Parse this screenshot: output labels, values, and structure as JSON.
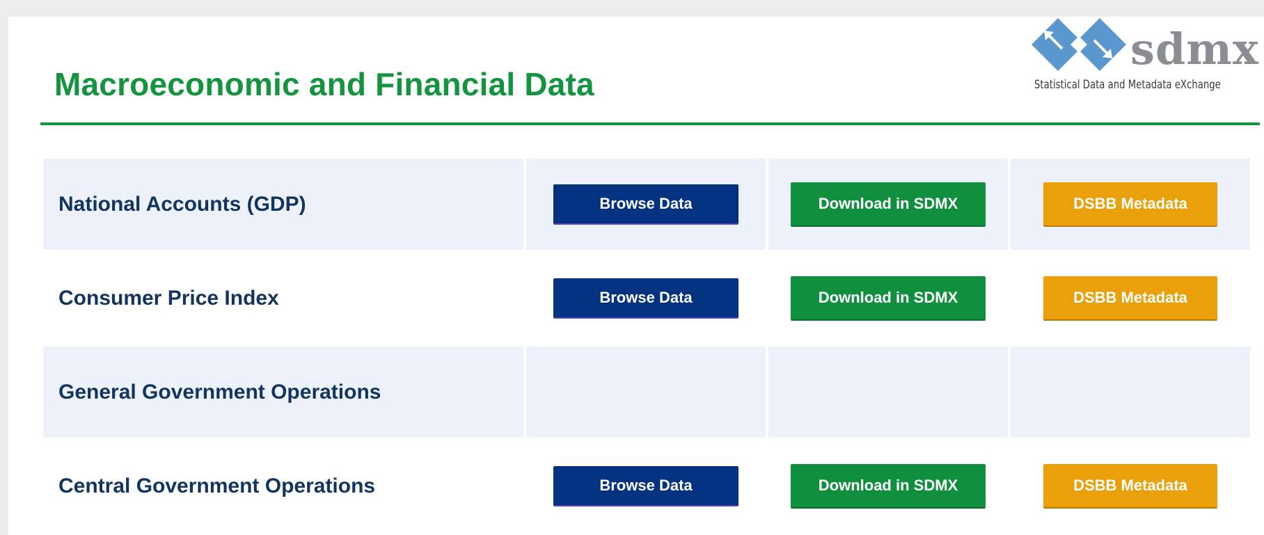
{
  "header": {
    "title": "Macroeconomic and Financial Data"
  },
  "logo": {
    "word": "sdmx",
    "tagline": "Statistical Data and Metadata eXchange",
    "colors": {
      "diamond": "#5b97cf",
      "word": "#8a8e92"
    }
  },
  "colors": {
    "title_green": "#14943f",
    "browse_blue": "#033280",
    "download_green": "#10903f",
    "metadata_orange": "#eaa00a",
    "row_shade": "#edf2fa",
    "label_navy": "#13345f"
  },
  "rows": [
    {
      "label": "National Accounts (GDP)",
      "shaded": true,
      "has_buttons": true,
      "browse": "Browse Data",
      "download": "Download in SDMX",
      "metadata": "DSBB Metadata"
    },
    {
      "label": "Consumer Price Index",
      "shaded": false,
      "has_buttons": true,
      "browse": "Browse Data",
      "download": "Download in SDMX",
      "metadata": "DSBB Metadata"
    },
    {
      "label": "General Government Operations",
      "shaded": true,
      "has_buttons": false
    },
    {
      "label": "Central Government Operations",
      "shaded": false,
      "has_buttons": true,
      "browse": "Browse Data",
      "download": "Download in SDMX",
      "metadata": "DSBB Metadata"
    }
  ]
}
